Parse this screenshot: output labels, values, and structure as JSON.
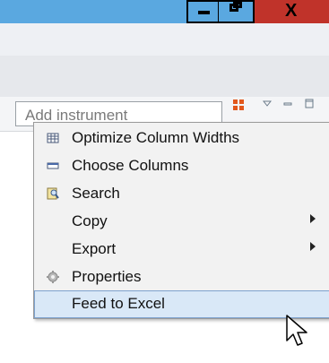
{
  "search": {
    "placeholder": "Add instrument"
  },
  "window_controls": {
    "minimize_icon": "minimize-icon",
    "maximize_icon": "restore-icon",
    "close_glyph": "X"
  },
  "toolbar_icons": [
    "grid-view-icon",
    "view-menu-icon",
    "minimize-view-icon",
    "maximize-view-icon"
  ],
  "menu": {
    "items": [
      {
        "label": "Optimize Column Widths",
        "icon": "table-icon",
        "submenu": false,
        "highlighted": false
      },
      {
        "label": "Choose Columns",
        "icon": "columns-icon",
        "submenu": false,
        "highlighted": false
      },
      {
        "label": "Search",
        "icon": "search-icon",
        "submenu": false,
        "highlighted": false
      },
      {
        "label": "Copy",
        "icon": "",
        "submenu": true,
        "highlighted": false
      },
      {
        "label": "Export",
        "icon": "",
        "submenu": true,
        "highlighted": false
      },
      {
        "label": "Properties",
        "icon": "gear-icon",
        "submenu": false,
        "highlighted": false
      },
      {
        "label": "Feed to Excel",
        "icon": "",
        "submenu": false,
        "highlighted": true
      }
    ]
  },
  "colors": {
    "titlebar": "#5aa8e0",
    "close_button": "#c0332a",
    "highlight": "#d9e8f7",
    "grid_icon": "#e2581d"
  }
}
